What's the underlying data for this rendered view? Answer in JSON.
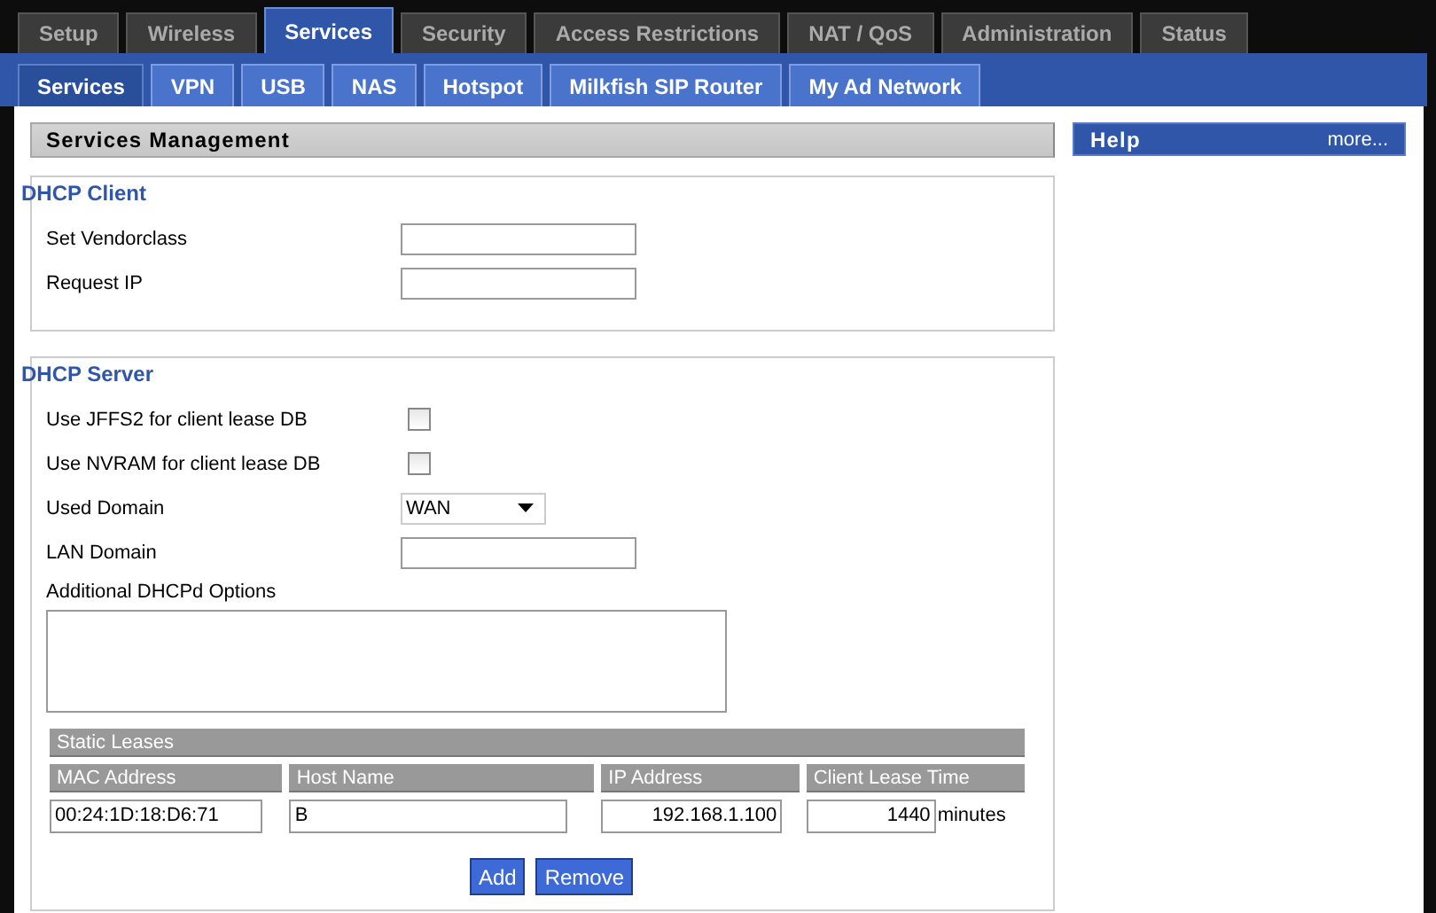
{
  "top_tabs": [
    {
      "label": "Setup",
      "selected": false
    },
    {
      "label": "Wireless",
      "selected": false
    },
    {
      "label": "Services",
      "selected": true
    },
    {
      "label": "Security",
      "selected": false
    },
    {
      "label": "Access Restrictions",
      "selected": false
    },
    {
      "label": "NAT / QoS",
      "selected": false
    },
    {
      "label": "Administration",
      "selected": false
    },
    {
      "label": "Status",
      "selected": false
    }
  ],
  "sub_tabs": [
    {
      "label": "Services",
      "selected": true
    },
    {
      "label": "VPN",
      "selected": false
    },
    {
      "label": "USB",
      "selected": false
    },
    {
      "label": "NAS",
      "selected": false
    },
    {
      "label": "Hotspot",
      "selected": false
    },
    {
      "label": "Milkfish SIP Router",
      "selected": false
    },
    {
      "label": "My Ad Network",
      "selected": false
    }
  ],
  "section_title": "Services Management",
  "help": {
    "title": "Help",
    "link": "more..."
  },
  "fieldsets": [
    {
      "legend": "DHCP Client",
      "rows": [
        {
          "kind": "text",
          "label": "Set Vendorclass"
        },
        {
          "kind": "text",
          "label": "Request IP"
        }
      ]
    },
    {
      "legend": "DHCP Server",
      "rows": [
        {
          "kind": "checkbox",
          "label": "Use JFFS2 for client lease DB",
          "checked": false
        },
        {
          "kind": "checkbox",
          "label": "Use NVRAM for client lease DB",
          "checked": false
        },
        {
          "kind": "select",
          "label": "Used Domain",
          "value": "WAN"
        },
        {
          "kind": "text",
          "label": "LAN Domain"
        },
        {
          "kind": "textarea",
          "label": "Additional DHCPd Options"
        }
      ],
      "static_leases": {
        "title": "Static Leases",
        "columns": [
          "MAC Address",
          "Host Name",
          "IP Address",
          "Client Lease Time"
        ],
        "rows": [
          {
            "mac": "00:24:1D:18:D6:71",
            "host": "B",
            "ip": "192.168.1.100",
            "lease": "1440",
            "unit": "minutes"
          }
        ],
        "buttons": [
          "Add",
          "Remove"
        ]
      }
    }
  ]
}
